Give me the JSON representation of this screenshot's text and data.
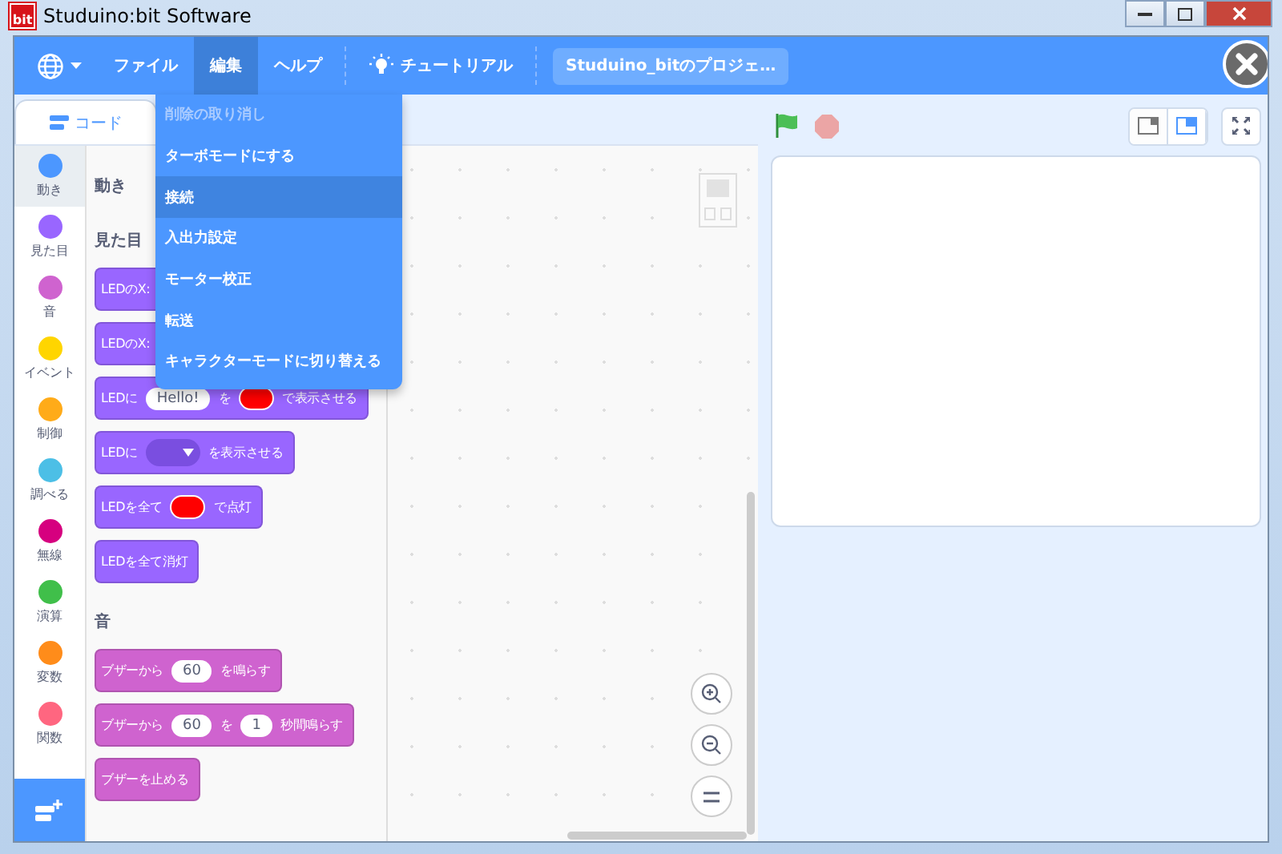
{
  "window": {
    "title": "Studuino:bit Software",
    "logo_text": "bit"
  },
  "menubar": {
    "items": [
      {
        "kind": "language"
      },
      {
        "kind": "menu",
        "label": "ファイル",
        "selected": false
      },
      {
        "kind": "menu",
        "label": "編集",
        "selected": true
      },
      {
        "kind": "menu",
        "label": "ヘルプ",
        "selected": false
      },
      {
        "kind": "tutorial",
        "label": "チュートリアル"
      }
    ],
    "project_title": "Studuino_bitのプロジェ…"
  },
  "edit_menu": [
    {
      "label": "削除の取り消し",
      "disabled": true,
      "selected": false
    },
    {
      "label": "ターボモードにする",
      "disabled": false,
      "selected": false
    },
    {
      "label": "接続",
      "disabled": false,
      "selected": true
    },
    {
      "label": "入出力設定",
      "disabled": false,
      "selected": false
    },
    {
      "label": "モーター校正",
      "disabled": false,
      "selected": false
    },
    {
      "label": "転送",
      "disabled": false,
      "selected": false
    },
    {
      "label": "キャラクターモードに切り替える",
      "disabled": false,
      "selected": false
    }
  ],
  "tabs": [
    {
      "label": "コード",
      "selected": true
    }
  ],
  "categories": [
    {
      "name": "動き",
      "color": "#4c97ff",
      "selected": true
    },
    {
      "name": "見た目",
      "color": "#9966ff",
      "selected": false
    },
    {
      "name": "音",
      "color": "#cf63cf",
      "selected": false
    },
    {
      "name": "イベント",
      "color": "#ffd500",
      "selected": false
    },
    {
      "name": "制御",
      "color": "#ffab19",
      "selected": false
    },
    {
      "name": "調べる",
      "color": "#4cbfe6",
      "selected": false
    },
    {
      "name": "無線",
      "color": "#d6007f",
      "selected": false
    },
    {
      "name": "演算",
      "color": "#40bf4a",
      "selected": false
    },
    {
      "name": "変数",
      "color": "#ff8c1a",
      "selected": false
    },
    {
      "name": "関数",
      "color": "#ff6680",
      "selected": false
    }
  ],
  "palette": [
    {
      "heading": "動き"
    },
    {
      "heading": "見た目",
      "blocks": [
        {
          "color": "#9966ff",
          "covered": true,
          "parts": [
            {
              "kind": "text",
              "text": "LEDのX:"
            }
          ]
        },
        {
          "color": "#9966ff",
          "covered": true,
          "parts": [
            {
              "kind": "text",
              "text": "LEDのX:"
            }
          ]
        },
        {
          "color": "#9966ff",
          "covered": false,
          "parts": [
            {
              "kind": "text",
              "text": "LEDに"
            },
            {
              "kind": "field",
              "text": "Hello!"
            },
            {
              "kind": "text",
              "text": "を"
            },
            {
              "kind": "color",
              "color": "#ff0000"
            },
            {
              "kind": "text",
              "text": "で表示させる"
            }
          ]
        },
        {
          "color": "#9966ff",
          "covered": false,
          "parts": [
            {
              "kind": "text",
              "text": "LEDに"
            },
            {
              "kind": "matrix"
            },
            {
              "kind": "text",
              "text": "を表示させる"
            }
          ]
        },
        {
          "color": "#9966ff",
          "covered": false,
          "parts": [
            {
              "kind": "text",
              "text": "LEDを全て"
            },
            {
              "kind": "color",
              "color": "#ff0000"
            },
            {
              "kind": "text",
              "text": "で点灯"
            }
          ]
        },
        {
          "color": "#9966ff",
          "covered": false,
          "parts": [
            {
              "kind": "text",
              "text": "LEDを全て消灯"
            }
          ]
        }
      ]
    },
    {
      "heading": "音",
      "blocks": [
        {
          "color": "#cf63cf",
          "covered": false,
          "parts": [
            {
              "kind": "text",
              "text": "ブザーから"
            },
            {
              "kind": "field",
              "text": "60"
            },
            {
              "kind": "text",
              "text": "を鳴らす"
            }
          ]
        },
        {
          "color": "#cf63cf",
          "covered": false,
          "parts": [
            {
              "kind": "text",
              "text": "ブザーから"
            },
            {
              "kind": "field",
              "text": "60"
            },
            {
              "kind": "text",
              "text": "を"
            },
            {
              "kind": "field",
              "text": "1"
            },
            {
              "kind": "text",
              "text": "秒間鳴らす"
            }
          ]
        },
        {
          "color": "#cf63cf",
          "covered": false,
          "parts": [
            {
              "kind": "text",
              "text": "ブザーを止める"
            }
          ]
        }
      ]
    }
  ],
  "stage_modes": [
    {
      "kind": "small",
      "selected": false
    },
    {
      "kind": "normal",
      "selected": true
    }
  ]
}
